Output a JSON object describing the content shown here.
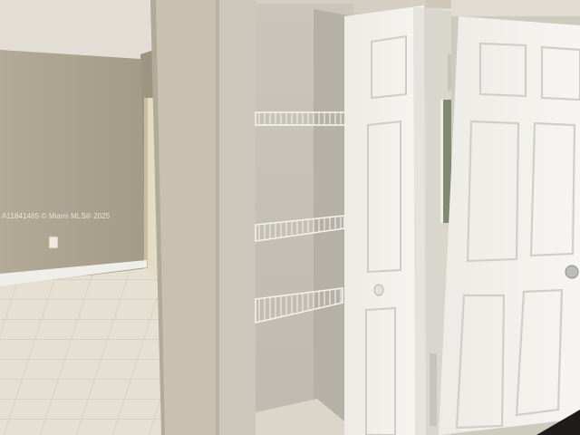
{
  "photo": {
    "watermark": "A11841465 © Miami MLS® 2025"
  }
}
